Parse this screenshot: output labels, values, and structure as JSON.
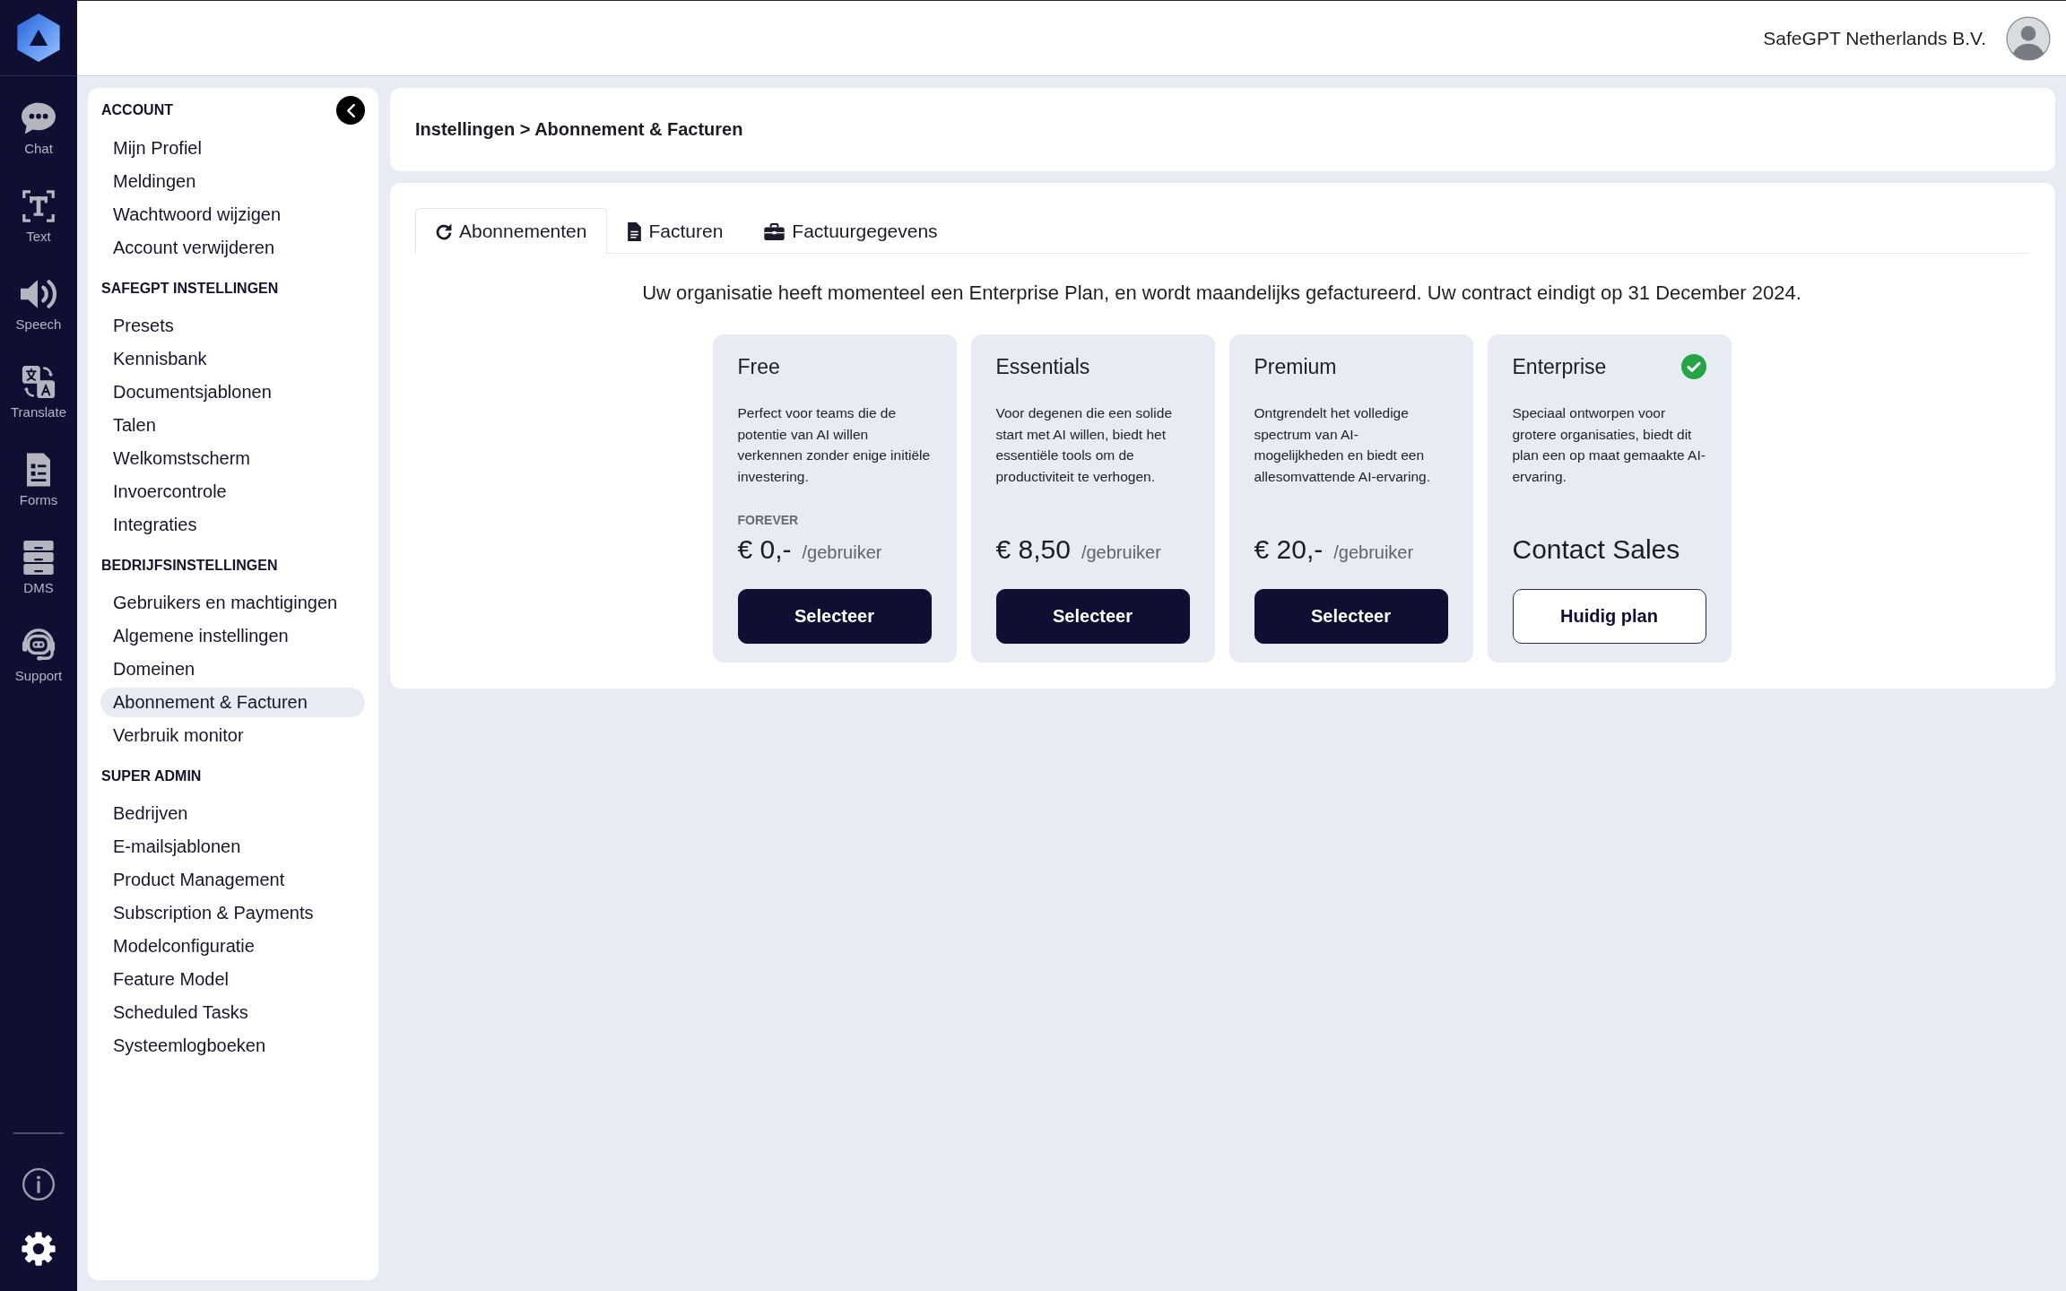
{
  "nav_rail": {
    "items": [
      {
        "label": "Chat",
        "selected": false
      },
      {
        "label": "Text",
        "selected": false
      },
      {
        "label": "Speech",
        "selected": false
      },
      {
        "label": "Translate",
        "selected": false
      },
      {
        "label": "Forms",
        "selected": false
      },
      {
        "label": "DMS",
        "selected": false
      },
      {
        "label": "Support",
        "selected": false
      }
    ],
    "footer": [
      {
        "selected": false
      },
      {
        "selected": true
      }
    ]
  },
  "top_bar": {
    "company": "SafeGPT Netherlands B.V."
  },
  "sidebar": {
    "sections": [
      {
        "title": "ACCOUNT",
        "items": [
          {
            "label": "Mijn Profiel",
            "selected": false
          },
          {
            "label": "Meldingen",
            "selected": false
          },
          {
            "label": "Wachtwoord wijzigen",
            "selected": false
          },
          {
            "label": "Account verwijderen",
            "selected": false
          }
        ]
      },
      {
        "title": "SAFEGPT INSTELLINGEN",
        "items": [
          {
            "label": "Presets",
            "selected": false
          },
          {
            "label": "Kennisbank",
            "selected": false
          },
          {
            "label": "Documentsjablonen",
            "selected": false
          },
          {
            "label": "Talen",
            "selected": false
          },
          {
            "label": "Welkomstscherm",
            "selected": false
          },
          {
            "label": "Invoercontrole",
            "selected": false
          },
          {
            "label": "Integraties",
            "selected": false
          }
        ]
      },
      {
        "title": "BEDRIJFSINSTELLINGEN",
        "items": [
          {
            "label": "Gebruikers en machtigingen",
            "selected": false
          },
          {
            "label": "Algemene instellingen",
            "selected": false
          },
          {
            "label": "Domeinen",
            "selected": false
          },
          {
            "label": "Abonnement & Facturen",
            "selected": true
          },
          {
            "label": "Verbruik monitor",
            "selected": false
          }
        ]
      },
      {
        "title": "SUPER ADMIN",
        "items": [
          {
            "label": "Bedrijven",
            "selected": false
          },
          {
            "label": "E-mailsjablonen",
            "selected": false
          },
          {
            "label": "Product Management",
            "selected": false
          },
          {
            "label": "Subscription & Payments",
            "selected": false
          },
          {
            "label": "Modelconfiguratie",
            "selected": false
          },
          {
            "label": "Feature Model",
            "selected": false
          },
          {
            "label": "Scheduled Tasks",
            "selected": false
          },
          {
            "label": "Systeemlogboeken",
            "selected": false
          }
        ]
      }
    ]
  },
  "breadcrumb": "Instellingen > Abonnement & Facturen",
  "tabs": [
    {
      "label": "Abonnementen",
      "selected": true
    },
    {
      "label": "Facturen",
      "selected": false
    },
    {
      "label": "Factuurgegevens",
      "selected": false
    }
  ],
  "notice": "Uw organisatie heeft momenteel een Enterprise Plan, en wordt maandelijks gefactureerd. Uw contract eindigt op 31 December 2024.",
  "plans": [
    {
      "name": "Free",
      "description": "Perfect voor teams die de potentie van AI willen verkennen zonder enige initiële investering.",
      "period": "FOREVER",
      "price": "€ 0,-",
      "unit": "/gebruiker",
      "button": "Selecteer",
      "current": false
    },
    {
      "name": "Essentials",
      "description": "Voor degenen die een solide start met AI willen, biedt het essentiële tools om de productiviteit te verhogen.",
      "price": "€ 8,50",
      "unit": "/gebruiker",
      "button": "Selecteer",
      "current": false
    },
    {
      "name": "Premium",
      "description": "Ontgrendelt het volledige spectrum van AI-mogelijkheden en biedt een allesomvattende AI-ervaring.",
      "price": "€ 20,-",
      "unit": "/gebruiker",
      "button": "Selecteer",
      "current": false
    },
    {
      "name": "Enterprise",
      "description": "Speciaal ontworpen voor grotere organisaties, biedt dit plan een op maat gemaakte AI-ervaring.",
      "price": "Contact Sales",
      "button": "Huidig plan",
      "current": true
    }
  ]
}
